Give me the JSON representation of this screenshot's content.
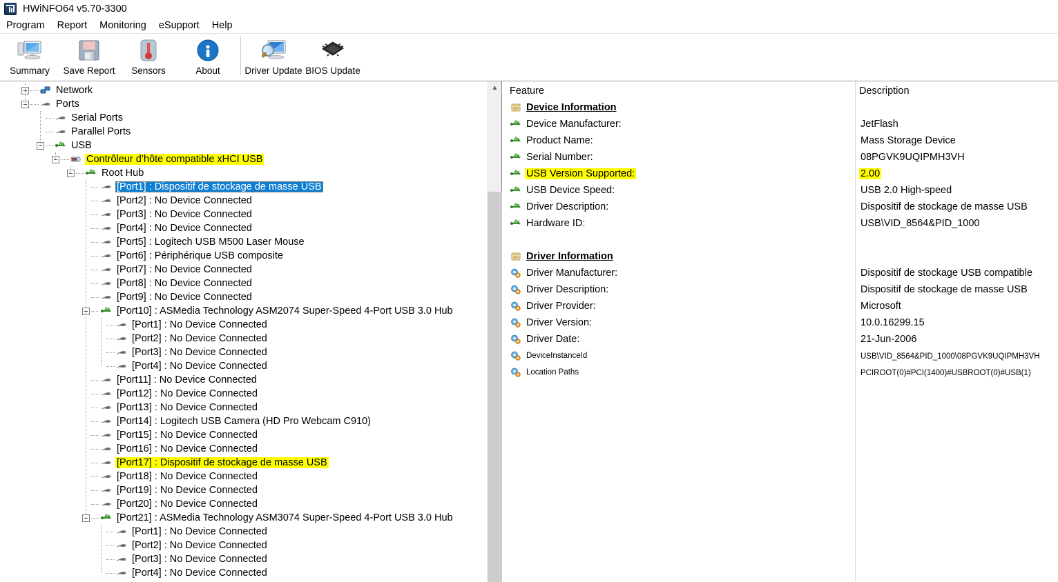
{
  "window": {
    "title": "HWiNFO64 v5.70-3300",
    "icon": "hwinfo-logo-icon"
  },
  "menubar": {
    "items": [
      {
        "label": "Program",
        "name": "menu-program"
      },
      {
        "label": "Report",
        "name": "menu-report"
      },
      {
        "label": "Monitoring",
        "name": "menu-monitoring"
      },
      {
        "label": "eSupport",
        "name": "menu-esupport"
      },
      {
        "label": "Help",
        "name": "menu-help"
      }
    ]
  },
  "toolbar": {
    "group1": [
      {
        "label": "Summary",
        "icon": "monitor-icon",
        "name": "toolbar-summary"
      },
      {
        "label": "Save Report",
        "icon": "floppy-disk-icon",
        "name": "toolbar-save-report"
      },
      {
        "label": "Sensors",
        "icon": "thermometer-icon",
        "name": "toolbar-sensors"
      },
      {
        "label": "About",
        "icon": "info-icon",
        "name": "toolbar-about"
      }
    ],
    "group2": [
      {
        "label": "Driver Update",
        "icon": "monitor-magnifier-icon",
        "name": "toolbar-driver-update"
      },
      {
        "label": "BIOS Update",
        "icon": "chip-icon",
        "name": "toolbar-bios-update"
      }
    ]
  },
  "tree": {
    "nodes": [
      {
        "indent": 0,
        "expander": "plus",
        "icon": "network-icon",
        "label": "Network",
        "state": "normal"
      },
      {
        "indent": 0,
        "expander": "minus",
        "icon": "usb-plug-icon",
        "label": "Ports",
        "state": "normal"
      },
      {
        "indent": 1,
        "expander": "none",
        "icon": "usb-plug-icon",
        "label": "Serial Ports",
        "state": "normal"
      },
      {
        "indent": 1,
        "expander": "none",
        "icon": "usb-plug-icon",
        "label": "Parallel Ports",
        "state": "normal"
      },
      {
        "indent": 1,
        "expander": "minus",
        "icon": "usb-hub-icon",
        "label": "USB",
        "state": "normal"
      },
      {
        "indent": 2,
        "expander": "minus",
        "icon": "usb-controller-icon",
        "label": "Contrôleur d’hôte compatible xHCI USB",
        "state": "highlight"
      },
      {
        "indent": 3,
        "expander": "minus",
        "icon": "usb-hub-icon",
        "label": "Root Hub",
        "state": "normal"
      },
      {
        "indent": 4,
        "expander": "none",
        "icon": "usb-plug-icon",
        "label": "[Port1] : Dispositif de stockage de masse USB",
        "state": "selected"
      },
      {
        "indent": 4,
        "expander": "none",
        "icon": "usb-plug-icon",
        "label": "[Port2] : No Device Connected",
        "state": "normal"
      },
      {
        "indent": 4,
        "expander": "none",
        "icon": "usb-plug-icon",
        "label": "[Port3] : No Device Connected",
        "state": "normal"
      },
      {
        "indent": 4,
        "expander": "none",
        "icon": "usb-plug-icon",
        "label": "[Port4] : No Device Connected",
        "state": "normal"
      },
      {
        "indent": 4,
        "expander": "none",
        "icon": "usb-plug-icon",
        "label": "[Port5] : Logitech USB M500 Laser Mouse",
        "state": "normal"
      },
      {
        "indent": 4,
        "expander": "none",
        "icon": "usb-plug-icon",
        "label": "[Port6] : Périphérique USB composite",
        "state": "normal"
      },
      {
        "indent": 4,
        "expander": "none",
        "icon": "usb-plug-icon",
        "label": "[Port7] : No Device Connected",
        "state": "normal"
      },
      {
        "indent": 4,
        "expander": "none",
        "icon": "usb-plug-icon",
        "label": "[Port8] : No Device Connected",
        "state": "normal"
      },
      {
        "indent": 4,
        "expander": "none",
        "icon": "usb-plug-icon",
        "label": "[Port9] : No Device Connected",
        "state": "normal"
      },
      {
        "indent": 4,
        "expander": "minus",
        "icon": "usb-hub-icon",
        "label": "[Port10] : ASMedia Technology ASM2074 Super-Speed 4-Port USB 3.0 Hub",
        "state": "normal"
      },
      {
        "indent": 5,
        "expander": "none",
        "icon": "usb-plug-icon",
        "label": "[Port1] : No Device Connected",
        "state": "normal"
      },
      {
        "indent": 5,
        "expander": "none",
        "icon": "usb-plug-icon",
        "label": "[Port2] : No Device Connected",
        "state": "normal"
      },
      {
        "indent": 5,
        "expander": "none",
        "icon": "usb-plug-icon",
        "label": "[Port3] : No Device Connected",
        "state": "normal"
      },
      {
        "indent": 5,
        "expander": "none",
        "icon": "usb-plug-icon",
        "label": "[Port4] : No Device Connected",
        "state": "normal"
      },
      {
        "indent": 4,
        "expander": "none",
        "icon": "usb-plug-icon",
        "label": "[Port11] : No Device Connected",
        "state": "normal"
      },
      {
        "indent": 4,
        "expander": "none",
        "icon": "usb-plug-icon",
        "label": "[Port12] : No Device Connected",
        "state": "normal"
      },
      {
        "indent": 4,
        "expander": "none",
        "icon": "usb-plug-icon",
        "label": "[Port13] : No Device Connected",
        "state": "normal"
      },
      {
        "indent": 4,
        "expander": "none",
        "icon": "usb-plug-icon",
        "label": "[Port14] : Logitech USB Camera (HD Pro Webcam C910)",
        "state": "normal"
      },
      {
        "indent": 4,
        "expander": "none",
        "icon": "usb-plug-icon",
        "label": "[Port15] : No Device Connected",
        "state": "normal"
      },
      {
        "indent": 4,
        "expander": "none",
        "icon": "usb-plug-icon",
        "label": "[Port16] : No Device Connected",
        "state": "normal"
      },
      {
        "indent": 4,
        "expander": "none",
        "icon": "usb-plug-icon",
        "label": "[Port17] : Dispositif de stockage de masse USB",
        "state": "highlight"
      },
      {
        "indent": 4,
        "expander": "none",
        "icon": "usb-plug-icon",
        "label": "[Port18] : No Device Connected",
        "state": "normal"
      },
      {
        "indent": 4,
        "expander": "none",
        "icon": "usb-plug-icon",
        "label": "[Port19] : No Device Connected",
        "state": "normal"
      },
      {
        "indent": 4,
        "expander": "none",
        "icon": "usb-plug-icon",
        "label": "[Port20] : No Device Connected",
        "state": "normal"
      },
      {
        "indent": 4,
        "expander": "minus",
        "icon": "usb-hub-icon",
        "label": "[Port21] : ASMedia Technology ASM3074 Super-Speed 4-Port USB 3.0 Hub",
        "state": "normal"
      },
      {
        "indent": 5,
        "expander": "none",
        "icon": "usb-plug-icon",
        "label": "[Port1] : No Device Connected",
        "state": "normal"
      },
      {
        "indent": 5,
        "expander": "none",
        "icon": "usb-plug-icon",
        "label": "[Port2] : No Device Connected",
        "state": "normal"
      },
      {
        "indent": 5,
        "expander": "none",
        "icon": "usb-plug-icon",
        "label": "[Port3] : No Device Connected",
        "state": "normal"
      },
      {
        "indent": 5,
        "expander": "none",
        "icon": "usb-plug-icon",
        "label": "[Port4] : No Device Connected",
        "state": "normal"
      }
    ]
  },
  "detail": {
    "columns": {
      "feature": "Feature",
      "description": "Description"
    },
    "rows": [
      {
        "kind": "section",
        "icon": "section-list-icon",
        "feature": "Device Information",
        "value": ""
      },
      {
        "kind": "item",
        "icon": "usb-hub-icon",
        "feature": "Device Manufacturer:",
        "value": "JetFlash"
      },
      {
        "kind": "item",
        "icon": "usb-hub-icon",
        "feature": "Product Name:",
        "value": "Mass Storage Device"
      },
      {
        "kind": "item",
        "icon": "usb-hub-icon",
        "feature": "Serial Number:",
        "value": "08PGVK9UQIPMH3VH"
      },
      {
        "kind": "item",
        "icon": "usb-hub-icon",
        "feature": "USB Version Supported:",
        "value": "2.00",
        "feature_highlight": true,
        "value_highlight": true
      },
      {
        "kind": "item",
        "icon": "usb-hub-icon",
        "feature": "USB Device Speed:",
        "value": "USB 2.0 High-speed"
      },
      {
        "kind": "item",
        "icon": "usb-hub-icon",
        "feature": "Driver Description:",
        "value": "Dispositif de stockage de masse USB"
      },
      {
        "kind": "item",
        "icon": "usb-hub-icon",
        "feature": "Hardware ID:",
        "value": "USB\\VID_8564&PID_1000"
      },
      {
        "kind": "spacer",
        "icon": "",
        "feature": "",
        "value": ""
      },
      {
        "kind": "section",
        "icon": "section-list-icon",
        "feature": "Driver Information",
        "value": ""
      },
      {
        "kind": "item",
        "icon": "gears-icon",
        "feature": "Driver Manufacturer:",
        "value": "Dispositif de stockage USB compatible"
      },
      {
        "kind": "item",
        "icon": "gears-icon",
        "feature": "Driver Description:",
        "value": "Dispositif de stockage de masse USB"
      },
      {
        "kind": "item",
        "icon": "gears-icon",
        "feature": "Driver Provider:",
        "value": "Microsoft"
      },
      {
        "kind": "item",
        "icon": "gears-icon",
        "feature": "Driver Version:",
        "value": "10.0.16299.15"
      },
      {
        "kind": "item",
        "icon": "gears-icon",
        "feature": "Driver Date:",
        "value": "21-Jun-2006"
      },
      {
        "kind": "item-small",
        "icon": "gears-icon",
        "feature": "DeviceInstanceId",
        "value": "USB\\VID_8564&PID_1000\\08PGVK9UQIPMH3VH"
      },
      {
        "kind": "item-small",
        "icon": "gears-icon",
        "feature": "Location Paths",
        "value": "PCIROOT(0)#PCI(1400)#USBROOT(0)#USB(1)"
      }
    ]
  },
  "colors": {
    "selection": "#0f7fd4",
    "highlight": "#ffff00",
    "focus_outline": "#c47b20",
    "scrollbar_thumb": "#cdcdcd",
    "usb_green": "#2e9e28"
  }
}
